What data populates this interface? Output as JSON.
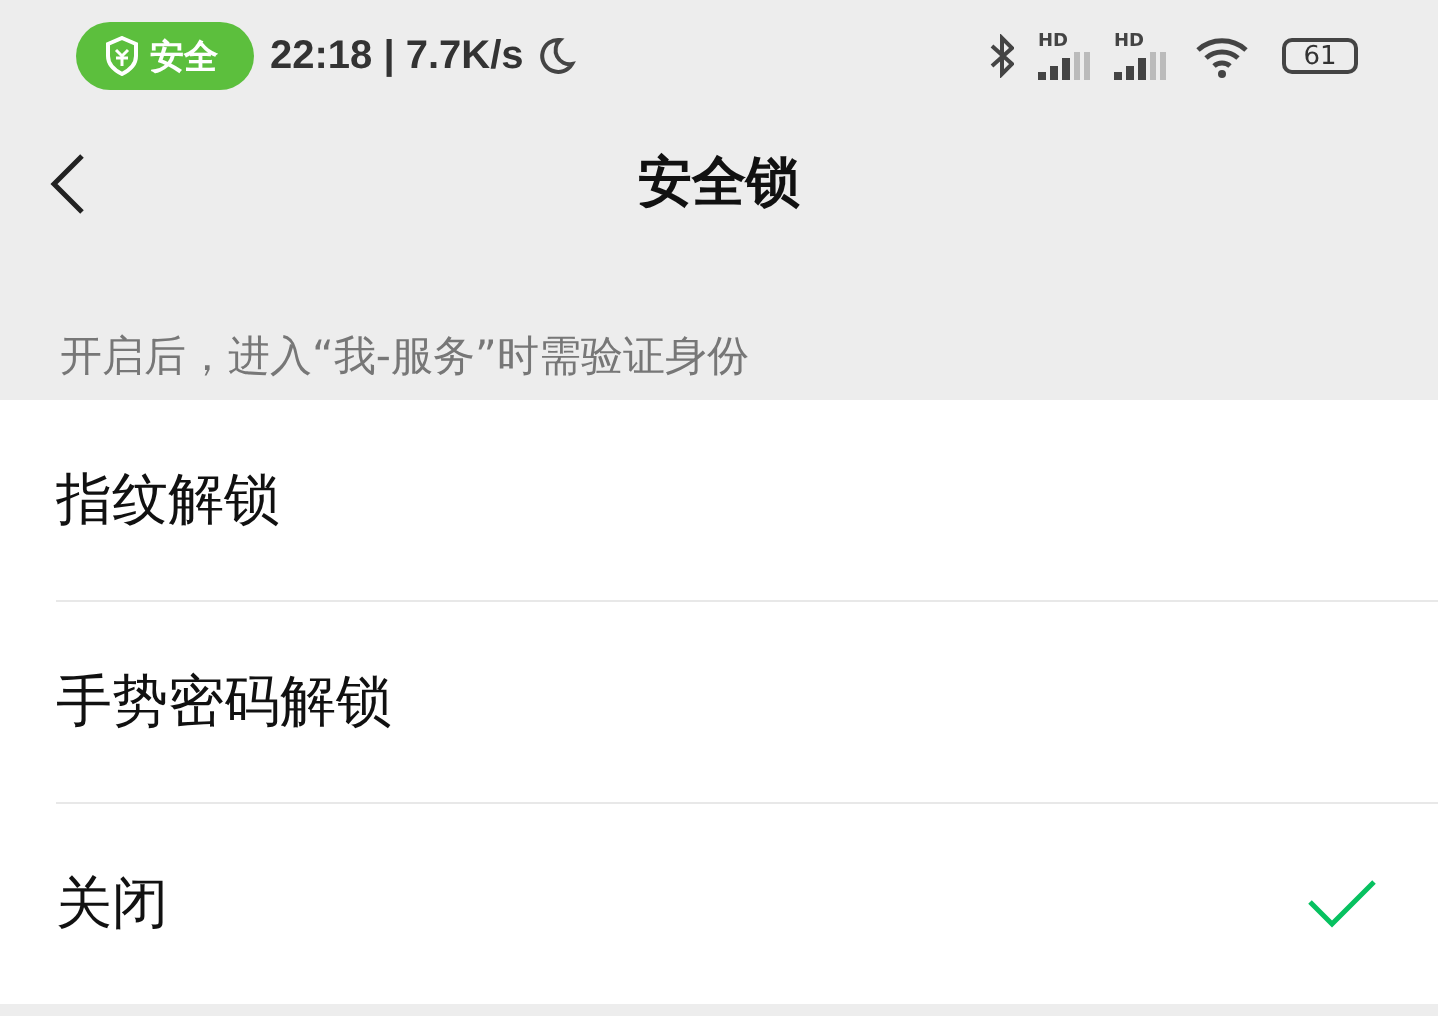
{
  "status_bar": {
    "security_badge": "安全",
    "time_speed": "22:18 | 7.7K/s",
    "signals": [
      {
        "label": "HD"
      },
      {
        "label": "HD"
      }
    ],
    "battery": "61"
  },
  "header": {
    "title": "安全锁"
  },
  "hint": "开启后，进入“我-服务”时需验证身份",
  "options": [
    {
      "label": "指纹解锁",
      "selected": false
    },
    {
      "label": "手势密码解锁",
      "selected": false
    },
    {
      "label": "关闭",
      "selected": true
    }
  ]
}
